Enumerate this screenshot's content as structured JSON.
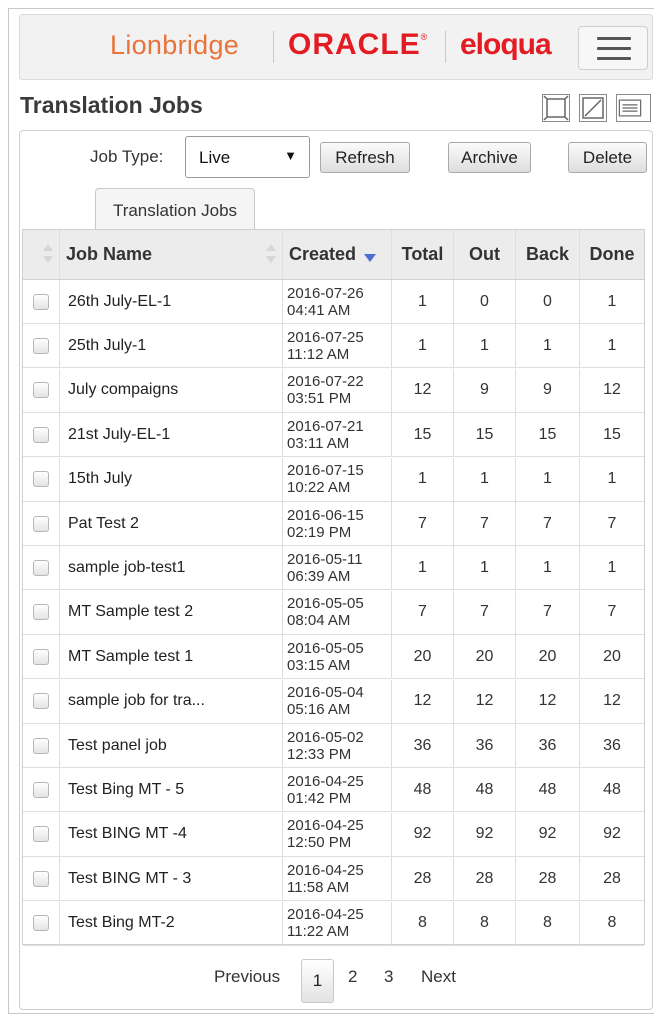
{
  "brand": {
    "lionbridge": "Lionbridge",
    "oracle": "ORACLE",
    "oracle_mark": "®",
    "eloqua": "eloqua",
    "lionbridge_color": "#e8743b",
    "oracle_color": "#e31b23"
  },
  "page": {
    "title": "Translation Jobs"
  },
  "toolbar": {
    "job_type_label": "Job Type:",
    "job_type_value": "Live",
    "refresh_label": "Refresh",
    "archive_label": "Archive",
    "delete_label": "Delete"
  },
  "tab": {
    "label": "Translation Jobs"
  },
  "table": {
    "headers": {
      "job_name": "Job Name",
      "created": "Created",
      "total": "Total",
      "out": "Out",
      "back": "Back",
      "done": "Done"
    },
    "rows": [
      {
        "name": "26th July-EL-1",
        "date": "2016-07-26",
        "time": "04:41 AM",
        "total": "1",
        "out": "0",
        "back": "0",
        "done": "1"
      },
      {
        "name": "25th July-1",
        "date": "2016-07-25",
        "time": "11:12 AM",
        "total": "1",
        "out": "1",
        "back": "1",
        "done": "1"
      },
      {
        "name": "July compaigns",
        "date": "2016-07-22",
        "time": "03:51 PM",
        "total": "12",
        "out": "9",
        "back": "9",
        "done": "12"
      },
      {
        "name": "21st July-EL-1",
        "date": "2016-07-21",
        "time": "03:11 AM",
        "total": "15",
        "out": "15",
        "back": "15",
        "done": "15"
      },
      {
        "name": "15th July",
        "date": "2016-07-15",
        "time": "10:22 AM",
        "total": "1",
        "out": "1",
        "back": "1",
        "done": "1"
      },
      {
        "name": "Pat Test 2",
        "date": "2016-06-15",
        "time": "02:19 PM",
        "total": "7",
        "out": "7",
        "back": "7",
        "done": "7"
      },
      {
        "name": "sample job-test1",
        "date": "2016-05-11",
        "time": "06:39 AM",
        "total": "1",
        "out": "1",
        "back": "1",
        "done": "1"
      },
      {
        "name": "MT Sample test 2",
        "date": "2016-05-05",
        "time": "08:04 AM",
        "total": "7",
        "out": "7",
        "back": "7",
        "done": "7"
      },
      {
        "name": "MT Sample test 1",
        "date": "2016-05-05",
        "time": "03:15 AM",
        "total": "20",
        "out": "20",
        "back": "20",
        "done": "20"
      },
      {
        "name": "sample job for tra...",
        "date": "2016-05-04",
        "time": "05:16 AM",
        "total": "12",
        "out": "12",
        "back": "12",
        "done": "12"
      },
      {
        "name": "Test panel job",
        "date": "2016-05-02",
        "time": "12:33 PM",
        "total": "36",
        "out": "36",
        "back": "36",
        "done": "36"
      },
      {
        "name": "Test Bing MT - 5",
        "date": "2016-04-25",
        "time": "01:42 PM",
        "total": "48",
        "out": "48",
        "back": "48",
        "done": "48"
      },
      {
        "name": "Test BING MT -4",
        "date": "2016-04-25",
        "time": "12:50 PM",
        "total": "92",
        "out": "92",
        "back": "92",
        "done": "92"
      },
      {
        "name": "Test BING MT - 3",
        "date": "2016-04-25",
        "time": "11:58 AM",
        "total": "28",
        "out": "28",
        "back": "28",
        "done": "28"
      },
      {
        "name": "Test Bing MT-2",
        "date": "2016-04-25",
        "time": "11:22 AM",
        "total": "8",
        "out": "8",
        "back": "8",
        "done": "8"
      }
    ]
  },
  "pagination": {
    "previous": "Previous",
    "current": "1",
    "pages": [
      "2",
      "3"
    ],
    "next": "Next"
  }
}
